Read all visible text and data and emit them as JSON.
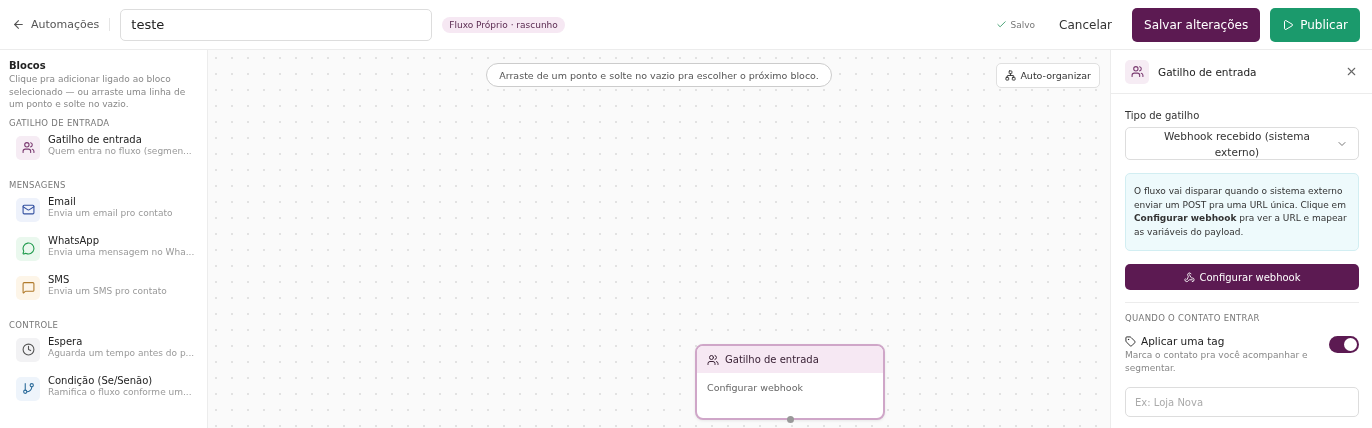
{
  "header": {
    "back_label": "Automações",
    "name_value": "teste",
    "status_badge": "Fluxo Próprio · rascunho",
    "saved_label": "Salvo",
    "cancel_label": "Cancelar",
    "save_label": "Salvar alterações",
    "publish_label": "Publicar"
  },
  "sidebar": {
    "title": "Blocos",
    "description": "Clique pra adicionar ligado ao bloco selecionado — ou arraste uma linha de um ponto e solte no vazio.",
    "sections": [
      {
        "title": "GATILHO DE ENTRADA",
        "items": [
          {
            "kind": "trigger",
            "name": "Gatilho de entrada",
            "description": "Quem entra no fluxo (segmen..."
          }
        ]
      },
      {
        "title": "MENSAGENS",
        "items": [
          {
            "kind": "email",
            "name": "Email",
            "description": "Envia um email pro contato"
          },
          {
            "kind": "whatsapp",
            "name": "WhatsApp",
            "description": "Envia uma mensagem no Wha..."
          },
          {
            "kind": "sms",
            "name": "SMS",
            "description": "Envia um SMS pro contato"
          }
        ]
      },
      {
        "title": "CONTROLE",
        "items": [
          {
            "kind": "wait",
            "name": "Espera",
            "description": "Aguarda um tempo antes do p..."
          },
          {
            "kind": "branch",
            "name": "Condição (Se/Senão)",
            "description": "Ramifica o fluxo conforme um..."
          }
        ]
      }
    ]
  },
  "canvas": {
    "hint": "Arraste de um ponto e solte no vazio pra escolher o próximo bloco.",
    "auto_arrange_label": "Auto-organizar",
    "nodes": [
      {
        "title": "Gatilho de entrada",
        "body": "Configurar webhook",
        "selected": true
      }
    ]
  },
  "panel": {
    "title": "Gatilho de entrada",
    "trigger_type_label": "Tipo de gatilho",
    "trigger_type_value": "Webhook recebido (sistema externo)",
    "info": "O fluxo vai disparar quando o sistema externo enviar um POST pra uma URL única. Clique em **Configurar webhook** pra ver a URL e mapear as variáveis do payload.",
    "configure_label": "Configurar webhook",
    "section_title": "QUANDO O CONTATO ENTRAR",
    "tag_toggle": {
      "label": "Aplicar uma tag",
      "description": "Marca o contato pra você acompanhar e segmentar.",
      "on": true
    },
    "tag_placeholder": "Ex: Loja Nova"
  }
}
